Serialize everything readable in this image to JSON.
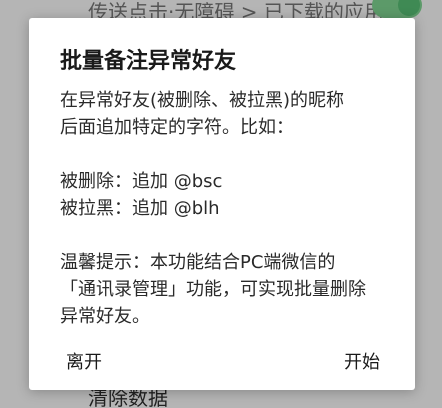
{
  "background": {
    "top_text": "传送点击·无障碍 > 已下载的应用",
    "bottom_text": "清除数据",
    "toggle_color": "#3f8a54"
  },
  "dialog": {
    "title": "批量备注异常好友",
    "lines": [
      "在异常好友(被删除、被拉黑)的昵称",
      "后面追加特定的字符。比如：",
      "",
      "被删除：追加 @bsc",
      "被拉黑：追加 @blh",
      "",
      "温馨提示：本功能结合PC端微信的",
      "「通讯录管理」功能，可实现批量删除",
      "异常好友。"
    ],
    "buttons": {
      "leave": "离开",
      "start": "开始"
    }
  }
}
